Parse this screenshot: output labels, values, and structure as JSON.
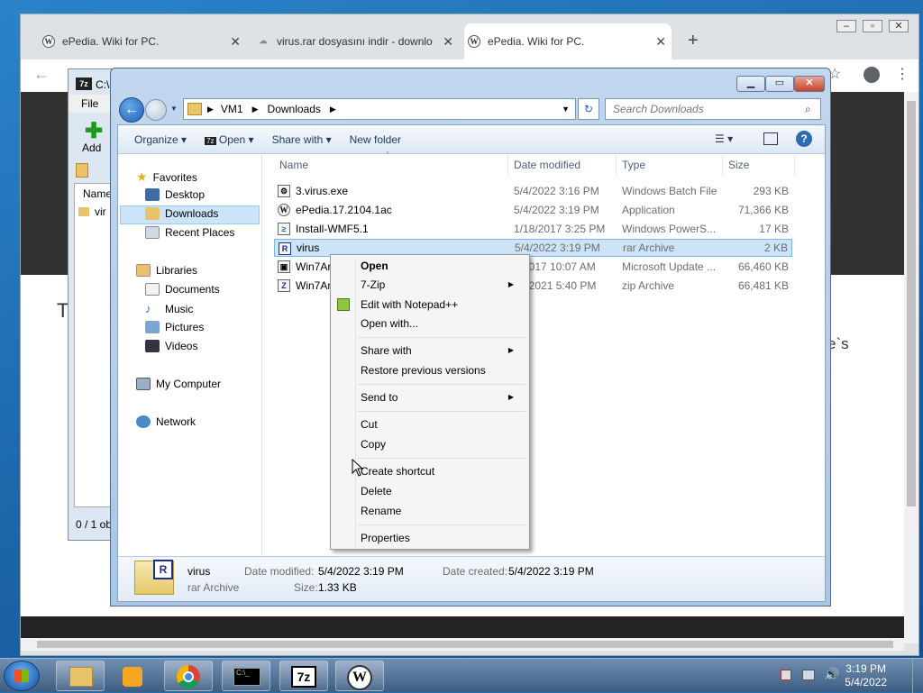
{
  "browser": {
    "tabs": [
      {
        "title": "ePedia. Wiki for PC."
      },
      {
        "title": "virus.rar dosyasını indir - downlo"
      },
      {
        "title": "ePedia. Wiki for PC."
      }
    ],
    "new_tab": "+",
    "page_text_left": "T",
    "page_text_right": "e`s"
  },
  "sevenzip": {
    "title": "C:\\",
    "menu_file": "File",
    "add_label": "Add",
    "col_name": "Name",
    "item": "vir",
    "status": "0 / 1 ob"
  },
  "explorer": {
    "breadcrumb": [
      "VM1",
      "Downloads"
    ],
    "search_placeholder": "Search Downloads",
    "toolbar": {
      "organize": "Organize",
      "open": "Open",
      "share_with": "Share with",
      "new_folder": "New folder"
    },
    "nav": {
      "favorites": "Favorites",
      "desktop": "Desktop",
      "downloads": "Downloads",
      "recent_places": "Recent Places",
      "libraries": "Libraries",
      "documents": "Documents",
      "music": "Music",
      "pictures": "Pictures",
      "videos": "Videos",
      "my_computer": "My Computer",
      "network": "Network"
    },
    "columns": {
      "name": "Name",
      "date": "Date modified",
      "type": "Type",
      "size": "Size"
    },
    "files": [
      {
        "name": "3.virus.exe",
        "date": "5/4/2022 3:16 PM",
        "type": "Windows Batch File",
        "size": "293 KB"
      },
      {
        "name": "ePedia.17.2104.1ac",
        "date": "5/4/2022 3:19 PM",
        "type": "Application",
        "size": "71,366 KB"
      },
      {
        "name": "Install-WMF5.1",
        "date": "1/18/2017 3:25 PM",
        "type": "Windows PowerS...",
        "size": "17 KB"
      },
      {
        "name": "virus",
        "date": "5/4/2022 3:19 PM",
        "type": "rar Archive",
        "size": "2 KB"
      },
      {
        "name": "Win7Ar",
        "date": "3/2017 10:07 AM",
        "type": "Microsoft Update ...",
        "size": "66,460 KB"
      },
      {
        "name": "Win7Ar",
        "date": "30/2021 5:40 PM",
        "type": "zip Archive",
        "size": "66,481 KB"
      }
    ],
    "details": {
      "name": "virus",
      "type": "rar Archive",
      "date_modified_label": "Date modified:",
      "date_modified": "5/4/2022 3:19 PM",
      "date_created_label": "Date created:",
      "date_created": "5/4/2022 3:19 PM",
      "size_label": "Size:",
      "size": "1.33 KB"
    }
  },
  "context_menu": {
    "open": "Open",
    "zip": "7-Zip",
    "notepad": "Edit with Notepad++",
    "open_with": "Open with...",
    "share_with": "Share with",
    "restore": "Restore previous versions",
    "send_to": "Send to",
    "cut": "Cut",
    "copy": "Copy",
    "create_shortcut": "Create shortcut",
    "delete": "Delete",
    "rename": "Rename",
    "properties": "Properties"
  },
  "taskbar": {
    "time": "3:19 PM",
    "date": "5/4/2022"
  }
}
